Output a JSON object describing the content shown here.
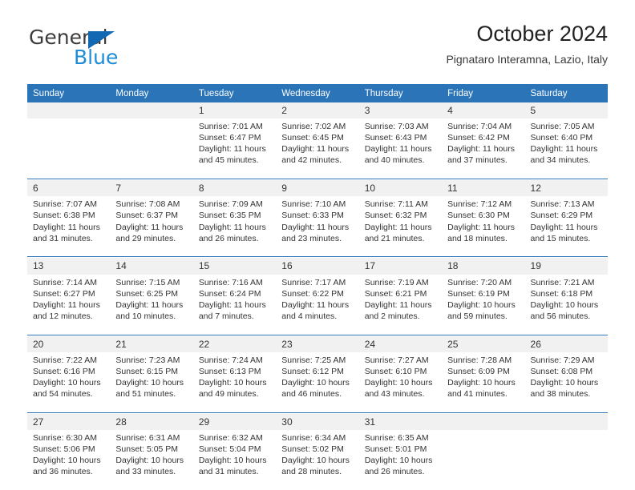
{
  "brand": {
    "name_top": "General",
    "name_bottom": "Blue",
    "triangle_icon": "triangle-logo-icon",
    "color_top": "#3c3c3c",
    "color_bottom": "#1e8bd8",
    "triangle_color": "#1268b3"
  },
  "header": {
    "title": "October 2024",
    "subtitle": "Pignataro Interamna, Lazio, Italy"
  },
  "theme": {
    "header_blue": "#2b74b8",
    "daynum_band": "#f1f1f1",
    "text": "#333333"
  },
  "weekday_headers": [
    "Sunday",
    "Monday",
    "Tuesday",
    "Wednesday",
    "Thursday",
    "Friday",
    "Saturday"
  ],
  "labels": {
    "sunrise_prefix": "Sunrise: ",
    "sunset_prefix": "Sunset: ",
    "daylight_prefix": "Daylight: "
  },
  "weeks": [
    [
      {
        "day": "",
        "sunrise": "",
        "sunset": "",
        "daylight_line1": "",
        "daylight_line2": ""
      },
      {
        "day": "",
        "sunrise": "",
        "sunset": "",
        "daylight_line1": "",
        "daylight_line2": ""
      },
      {
        "day": "1",
        "sunrise": "Sunrise: 7:01 AM",
        "sunset": "Sunset: 6:47 PM",
        "daylight_line1": "Daylight: 11 hours",
        "daylight_line2": "and 45 minutes."
      },
      {
        "day": "2",
        "sunrise": "Sunrise: 7:02 AM",
        "sunset": "Sunset: 6:45 PM",
        "daylight_line1": "Daylight: 11 hours",
        "daylight_line2": "and 42 minutes."
      },
      {
        "day": "3",
        "sunrise": "Sunrise: 7:03 AM",
        "sunset": "Sunset: 6:43 PM",
        "daylight_line1": "Daylight: 11 hours",
        "daylight_line2": "and 40 minutes."
      },
      {
        "day": "4",
        "sunrise": "Sunrise: 7:04 AM",
        "sunset": "Sunset: 6:42 PM",
        "daylight_line1": "Daylight: 11 hours",
        "daylight_line2": "and 37 minutes."
      },
      {
        "day": "5",
        "sunrise": "Sunrise: 7:05 AM",
        "sunset": "Sunset: 6:40 PM",
        "daylight_line1": "Daylight: 11 hours",
        "daylight_line2": "and 34 minutes."
      }
    ],
    [
      {
        "day": "6",
        "sunrise": "Sunrise: 7:07 AM",
        "sunset": "Sunset: 6:38 PM",
        "daylight_line1": "Daylight: 11 hours",
        "daylight_line2": "and 31 minutes."
      },
      {
        "day": "7",
        "sunrise": "Sunrise: 7:08 AM",
        "sunset": "Sunset: 6:37 PM",
        "daylight_line1": "Daylight: 11 hours",
        "daylight_line2": "and 29 minutes."
      },
      {
        "day": "8",
        "sunrise": "Sunrise: 7:09 AM",
        "sunset": "Sunset: 6:35 PM",
        "daylight_line1": "Daylight: 11 hours",
        "daylight_line2": "and 26 minutes."
      },
      {
        "day": "9",
        "sunrise": "Sunrise: 7:10 AM",
        "sunset": "Sunset: 6:33 PM",
        "daylight_line1": "Daylight: 11 hours",
        "daylight_line2": "and 23 minutes."
      },
      {
        "day": "10",
        "sunrise": "Sunrise: 7:11 AM",
        "sunset": "Sunset: 6:32 PM",
        "daylight_line1": "Daylight: 11 hours",
        "daylight_line2": "and 21 minutes."
      },
      {
        "day": "11",
        "sunrise": "Sunrise: 7:12 AM",
        "sunset": "Sunset: 6:30 PM",
        "daylight_line1": "Daylight: 11 hours",
        "daylight_line2": "and 18 minutes."
      },
      {
        "day": "12",
        "sunrise": "Sunrise: 7:13 AM",
        "sunset": "Sunset: 6:29 PM",
        "daylight_line1": "Daylight: 11 hours",
        "daylight_line2": "and 15 minutes."
      }
    ],
    [
      {
        "day": "13",
        "sunrise": "Sunrise: 7:14 AM",
        "sunset": "Sunset: 6:27 PM",
        "daylight_line1": "Daylight: 11 hours",
        "daylight_line2": "and 12 minutes."
      },
      {
        "day": "14",
        "sunrise": "Sunrise: 7:15 AM",
        "sunset": "Sunset: 6:25 PM",
        "daylight_line1": "Daylight: 11 hours",
        "daylight_line2": "and 10 minutes."
      },
      {
        "day": "15",
        "sunrise": "Sunrise: 7:16 AM",
        "sunset": "Sunset: 6:24 PM",
        "daylight_line1": "Daylight: 11 hours",
        "daylight_line2": "and 7 minutes."
      },
      {
        "day": "16",
        "sunrise": "Sunrise: 7:17 AM",
        "sunset": "Sunset: 6:22 PM",
        "daylight_line1": "Daylight: 11 hours",
        "daylight_line2": "and 4 minutes."
      },
      {
        "day": "17",
        "sunrise": "Sunrise: 7:19 AM",
        "sunset": "Sunset: 6:21 PM",
        "daylight_line1": "Daylight: 11 hours",
        "daylight_line2": "and 2 minutes."
      },
      {
        "day": "18",
        "sunrise": "Sunrise: 7:20 AM",
        "sunset": "Sunset: 6:19 PM",
        "daylight_line1": "Daylight: 10 hours",
        "daylight_line2": "and 59 minutes."
      },
      {
        "day": "19",
        "sunrise": "Sunrise: 7:21 AM",
        "sunset": "Sunset: 6:18 PM",
        "daylight_line1": "Daylight: 10 hours",
        "daylight_line2": "and 56 minutes."
      }
    ],
    [
      {
        "day": "20",
        "sunrise": "Sunrise: 7:22 AM",
        "sunset": "Sunset: 6:16 PM",
        "daylight_line1": "Daylight: 10 hours",
        "daylight_line2": "and 54 minutes."
      },
      {
        "day": "21",
        "sunrise": "Sunrise: 7:23 AM",
        "sunset": "Sunset: 6:15 PM",
        "daylight_line1": "Daylight: 10 hours",
        "daylight_line2": "and 51 minutes."
      },
      {
        "day": "22",
        "sunrise": "Sunrise: 7:24 AM",
        "sunset": "Sunset: 6:13 PM",
        "daylight_line1": "Daylight: 10 hours",
        "daylight_line2": "and 49 minutes."
      },
      {
        "day": "23",
        "sunrise": "Sunrise: 7:25 AM",
        "sunset": "Sunset: 6:12 PM",
        "daylight_line1": "Daylight: 10 hours",
        "daylight_line2": "and 46 minutes."
      },
      {
        "day": "24",
        "sunrise": "Sunrise: 7:27 AM",
        "sunset": "Sunset: 6:10 PM",
        "daylight_line1": "Daylight: 10 hours",
        "daylight_line2": "and 43 minutes."
      },
      {
        "day": "25",
        "sunrise": "Sunrise: 7:28 AM",
        "sunset": "Sunset: 6:09 PM",
        "daylight_line1": "Daylight: 10 hours",
        "daylight_line2": "and 41 minutes."
      },
      {
        "day": "26",
        "sunrise": "Sunrise: 7:29 AM",
        "sunset": "Sunset: 6:08 PM",
        "daylight_line1": "Daylight: 10 hours",
        "daylight_line2": "and 38 minutes."
      }
    ],
    [
      {
        "day": "27",
        "sunrise": "Sunrise: 6:30 AM",
        "sunset": "Sunset: 5:06 PM",
        "daylight_line1": "Daylight: 10 hours",
        "daylight_line2": "and 36 minutes."
      },
      {
        "day": "28",
        "sunrise": "Sunrise: 6:31 AM",
        "sunset": "Sunset: 5:05 PM",
        "daylight_line1": "Daylight: 10 hours",
        "daylight_line2": "and 33 minutes."
      },
      {
        "day": "29",
        "sunrise": "Sunrise: 6:32 AM",
        "sunset": "Sunset: 5:04 PM",
        "daylight_line1": "Daylight: 10 hours",
        "daylight_line2": "and 31 minutes."
      },
      {
        "day": "30",
        "sunrise": "Sunrise: 6:34 AM",
        "sunset": "Sunset: 5:02 PM",
        "daylight_line1": "Daylight: 10 hours",
        "daylight_line2": "and 28 minutes."
      },
      {
        "day": "31",
        "sunrise": "Sunrise: 6:35 AM",
        "sunset": "Sunset: 5:01 PM",
        "daylight_line1": "Daylight: 10 hours",
        "daylight_line2": "and 26 minutes."
      },
      {
        "day": "",
        "sunrise": "",
        "sunset": "",
        "daylight_line1": "",
        "daylight_line2": ""
      },
      {
        "day": "",
        "sunrise": "",
        "sunset": "",
        "daylight_line1": "",
        "daylight_line2": ""
      }
    ]
  ]
}
